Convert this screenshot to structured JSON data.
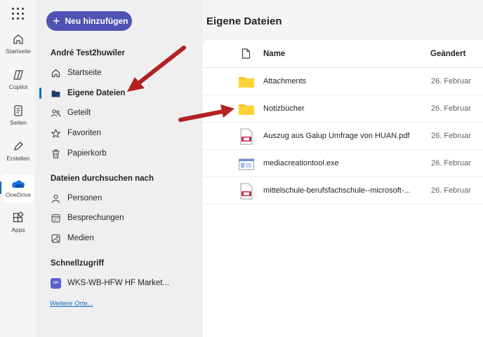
{
  "rail": {
    "items": [
      {
        "label": "Startseite",
        "icon": "home-icon"
      },
      {
        "label": "Copilot",
        "icon": "copilot-icon"
      },
      {
        "label": "Seiten",
        "icon": "pages-icon"
      },
      {
        "label": "Erstellen",
        "icon": "create-icon"
      },
      {
        "label": "OneDrive",
        "icon": "onedrive-icon"
      },
      {
        "label": "Apps",
        "icon": "apps-icon"
      }
    ]
  },
  "nav": {
    "new_button": "Neu hinzufügen",
    "user_section": "André Test2huwiler",
    "items": [
      {
        "label": "Startseite",
        "icon": "home-icon"
      },
      {
        "label": "Eigene Dateien",
        "icon": "folder-icon"
      },
      {
        "label": "Geteilt",
        "icon": "people-icon"
      },
      {
        "label": "Favoriten",
        "icon": "star-icon"
      },
      {
        "label": "Papierkorb",
        "icon": "trash-icon"
      }
    ],
    "browse_section": "Dateien durchsuchen nach",
    "browse_items": [
      {
        "label": "Personen",
        "icon": "person-icon"
      },
      {
        "label": "Besprechungen",
        "icon": "calendar-icon"
      },
      {
        "label": "Medien",
        "icon": "image-icon"
      }
    ],
    "quick_section": "Schnellzugriff",
    "quick_items": [
      {
        "label": "WKS-WB-HFW HF Market...",
        "badge": "WH"
      }
    ],
    "more_link": "Weitere Orte..."
  },
  "main": {
    "title": "Eigene Dateien",
    "columns": {
      "name": "Name",
      "modified": "Geändert"
    },
    "files": [
      {
        "name": "Attachments",
        "modified": "26. Februar",
        "type": "folder"
      },
      {
        "name": "Notizbücher",
        "modified": "26. Februar",
        "type": "folder"
      },
      {
        "name": "Auszug aus Galup Umfrage von HUAN.pdf",
        "modified": "26. Februar",
        "type": "pdf"
      },
      {
        "name": "mediacreationtool.exe",
        "modified": "26. Februar",
        "type": "exe"
      },
      {
        "name": "mittelschule-berufsfachschule--microsoft-...",
        "modified": "26. Februar",
        "type": "pdf"
      }
    ]
  },
  "colors": {
    "accent": "#4f52b2",
    "link": "#0f6cbd",
    "folder": "#f5c518",
    "annotation_arrow": "#b22222"
  }
}
